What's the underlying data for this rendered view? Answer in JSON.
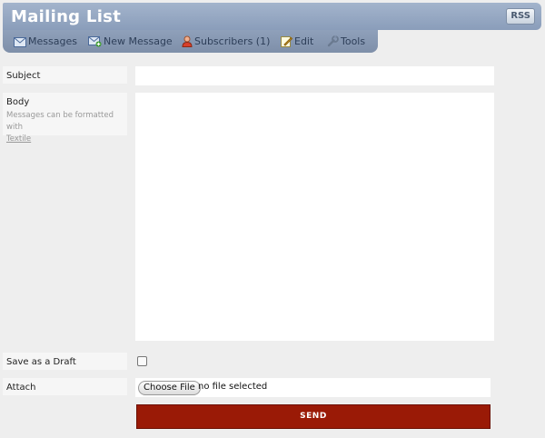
{
  "header": {
    "title": "Mailing List",
    "rss_label": "RSS"
  },
  "nav": {
    "items": [
      {
        "label": "Messages",
        "icon": "envelope-icon"
      },
      {
        "label": "New Message",
        "icon": "new-message-icon"
      },
      {
        "label": "Subscribers (1)",
        "icon": "person-icon"
      },
      {
        "label": "Edit",
        "icon": "edit-icon"
      },
      {
        "label": "Tools",
        "icon": "wrench-icon"
      }
    ]
  },
  "form": {
    "subject_label": "Subject",
    "body_label": "Body",
    "body_hint": "Messages can be formatted with",
    "body_hint_link": "Textile",
    "draft_label": "Save as a Draft",
    "attach_label": "Attach",
    "file_button": "Choose File",
    "file_status": "no file selected",
    "send_label": "SEND",
    "subject_value": "",
    "body_value": ""
  },
  "colors": {
    "accent": "#9a1a06",
    "header": "#8a9dba"
  }
}
